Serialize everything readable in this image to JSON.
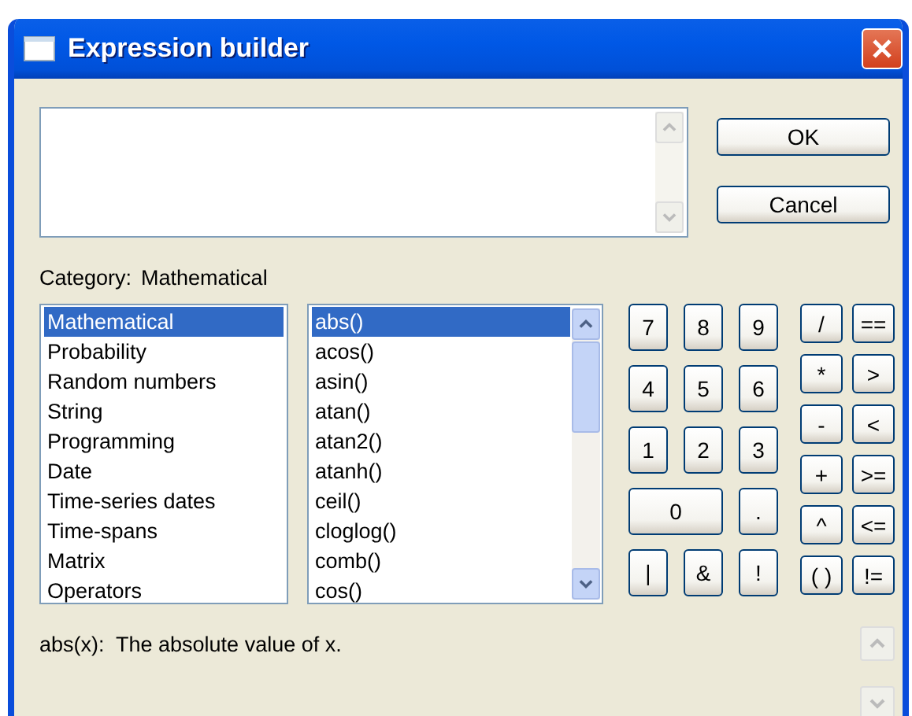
{
  "window": {
    "title": "Expression builder"
  },
  "buttons": [
    "OK",
    "Cancel"
  ],
  "category": {
    "label": "Category:",
    "value": "Mathematical"
  },
  "categories": [
    {
      "label": "Mathematical",
      "selected": true
    },
    {
      "label": "Probability",
      "selected": false
    },
    {
      "label": "Random numbers",
      "selected": false
    },
    {
      "label": "String",
      "selected": false
    },
    {
      "label": "Programming",
      "selected": false
    },
    {
      "label": "Date",
      "selected": false
    },
    {
      "label": "Time-series dates",
      "selected": false
    },
    {
      "label": "Time-spans",
      "selected": false
    },
    {
      "label": "Matrix",
      "selected": false
    },
    {
      "label": "Operators",
      "selected": false
    }
  ],
  "functions": [
    {
      "label": "abs()",
      "selected": true
    },
    {
      "label": "acos()",
      "selected": false
    },
    {
      "label": "asin()",
      "selected": false
    },
    {
      "label": "atan()",
      "selected": false
    },
    {
      "label": "atan2()",
      "selected": false
    },
    {
      "label": "atanh()",
      "selected": false
    },
    {
      "label": "ceil()",
      "selected": false
    },
    {
      "label": "cloglog()",
      "selected": false
    },
    {
      "label": "comb()",
      "selected": false
    },
    {
      "label": "cos()",
      "selected": false
    }
  ],
  "keypad": [
    {
      "label": "7",
      "kind": "normal"
    },
    {
      "label": "8",
      "kind": "normal"
    },
    {
      "label": "9",
      "kind": "normal"
    },
    {
      "label": "4",
      "kind": "normal"
    },
    {
      "label": "5",
      "kind": "normal"
    },
    {
      "label": "6",
      "kind": "normal"
    },
    {
      "label": "1",
      "kind": "normal"
    },
    {
      "label": "2",
      "kind": "normal"
    },
    {
      "label": "3",
      "kind": "normal"
    },
    {
      "label": "0",
      "kind": "wide"
    },
    {
      "label": ".",
      "kind": "normal"
    },
    {
      "label": "|",
      "kind": "normal"
    },
    {
      "label": "&",
      "kind": "normal"
    },
    {
      "label": "!",
      "kind": "normal"
    }
  ],
  "operators": [
    "/",
    "==",
    "*",
    ">",
    "-",
    "<",
    "+",
    ">=",
    "^",
    "<=",
    "( )",
    "!="
  ],
  "description": "abs(x):  The absolute value of x."
}
